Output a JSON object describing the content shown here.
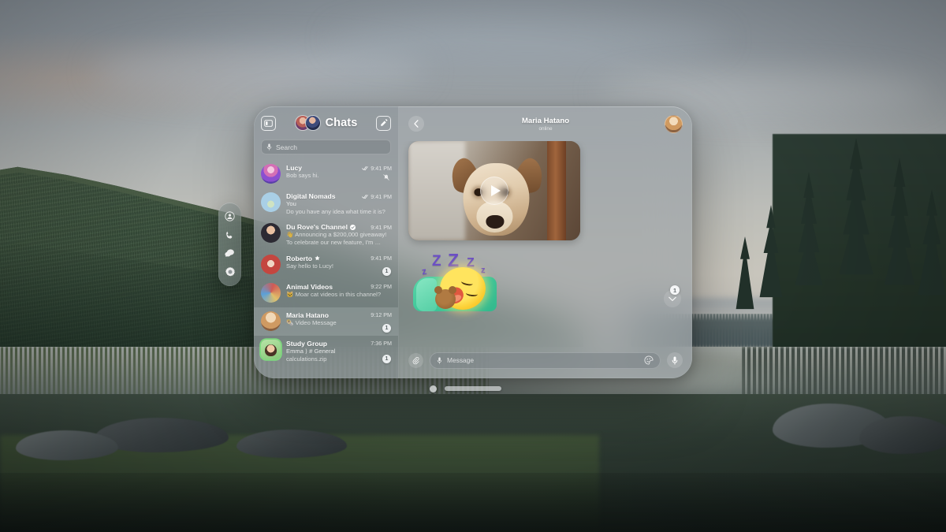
{
  "scene": {
    "description": "forest lake landscape wallpaper",
    "colors": {
      "sky": "#bcbdb8",
      "forest": "#3f5440",
      "lake": "#68736f",
      "shore": "#2f3c34"
    }
  },
  "tool_rail": {
    "items": [
      {
        "name": "contacts",
        "icon": "person-icon"
      },
      {
        "name": "calls",
        "icon": "phone-icon"
      },
      {
        "name": "chats",
        "icon": "chat-bubbles-icon"
      },
      {
        "name": "settings",
        "icon": "gear-icon"
      }
    ]
  },
  "sidebar": {
    "toggle_icon": "sidebar-toggle-icon",
    "title": "Chats",
    "compose_icon": "compose-icon",
    "search": {
      "placeholder": "Search",
      "icon": "mic-icon"
    },
    "chats": [
      {
        "name": "Lucy",
        "preview": "Bob says hi.",
        "sender": "",
        "time": "9:41 PM",
        "read_check": true,
        "verified": false,
        "star": false,
        "muted": true,
        "unread": "",
        "selected": false,
        "avatar_class": "av-lucy"
      },
      {
        "name": "Digital Nomads",
        "preview": "Do you have any idea what time it is?",
        "sender": "You",
        "time": "9:41 PM",
        "read_check": true,
        "verified": false,
        "star": false,
        "muted": false,
        "unread": "",
        "selected": false,
        "avatar_class": "av-nomads"
      },
      {
        "name": "Du Rove's Channel",
        "preview": "👋 Announcing a $200,000 giveaway!",
        "preview2": "To celebrate our new feature, I'm …",
        "sender": "",
        "time": "9:41 PM",
        "read_check": false,
        "verified": true,
        "star": false,
        "muted": false,
        "unread": "",
        "selected": false,
        "avatar_class": "av-durov"
      },
      {
        "name": "Roberto",
        "preview": "Say hello to Lucy!",
        "sender": "",
        "time": "9:41 PM",
        "read_check": false,
        "verified": false,
        "star": true,
        "muted": false,
        "unread": "1",
        "selected": false,
        "avatar_class": "av-roberto"
      },
      {
        "name": "Animal Videos",
        "preview": "🐱 Moar cat videos in this channel?",
        "sender": "",
        "time": "9:22 PM",
        "read_check": false,
        "verified": false,
        "star": false,
        "muted": false,
        "unread": "",
        "selected": false,
        "avatar_class": "av-animal"
      },
      {
        "name": "Maria Hatano",
        "preview": "🌯 Video Message",
        "sender": "",
        "time": "9:12 PM",
        "read_check": false,
        "verified": false,
        "star": false,
        "muted": false,
        "unread": "1",
        "selected": true,
        "avatar_class": "av-maria"
      },
      {
        "name": "Study Group",
        "preview": "calculations.zip",
        "sender": "Emma ⟩ # General",
        "time": "7:36 PM",
        "read_check": false,
        "verified": false,
        "star": false,
        "muted": true,
        "unread": "1",
        "selected": false,
        "active_call": true,
        "avatar_class": "av-study"
      }
    ]
  },
  "chat": {
    "back_icon": "chevron-left-icon",
    "contact_name": "Maria Hatano",
    "status": "online",
    "avatar_icon": "contact-avatar",
    "messages": [
      {
        "type": "video",
        "label": "video-message",
        "play_icon": "play-icon"
      },
      {
        "type": "sticker",
        "label": "sleeping-emoji-sticker",
        "zzz": [
          "z",
          "Z",
          "Z",
          "Z",
          "z"
        ]
      }
    ],
    "scroll_down": {
      "icon": "chevron-down-icon",
      "badge": "1"
    },
    "composer": {
      "attach_icon": "paperclip-icon",
      "mic_in_field_icon": "mic-icon",
      "placeholder": "Message",
      "sticker_icon": "sticker-icon",
      "voice_icon": "mic-icon"
    }
  },
  "window_chrome": {
    "close_icon": "window-close-dot",
    "grab_handle": "window-drag-handle"
  }
}
